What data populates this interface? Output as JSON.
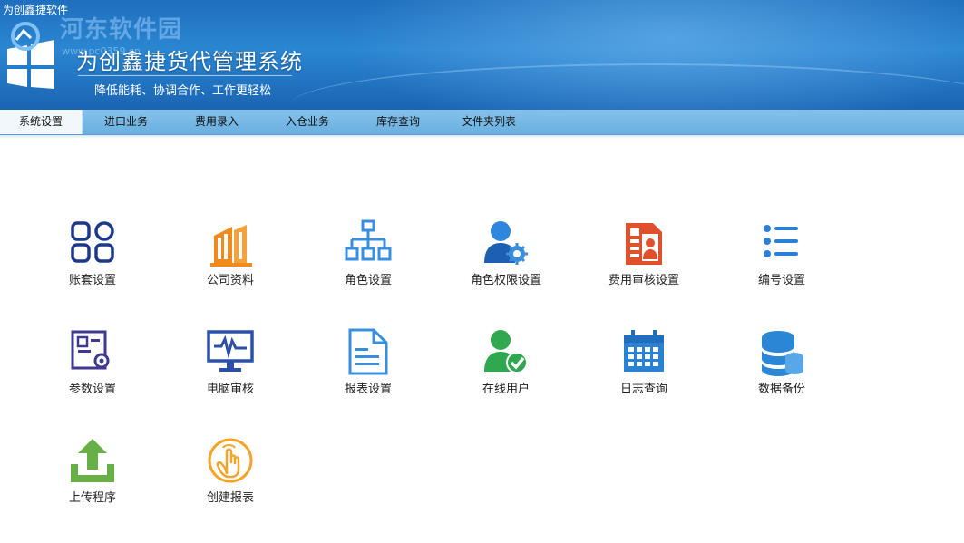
{
  "window": {
    "title": "为创鑫捷软件"
  },
  "banner": {
    "watermark": "河东软件园",
    "watermark_url": "www.pc0359.cn",
    "app_title": "为创鑫捷货代管理系统",
    "subtitle": "降低能耗、协调合作、工作更轻松"
  },
  "menu": {
    "tabs": [
      {
        "label": "系统设置",
        "active": true
      },
      {
        "label": "进口业务"
      },
      {
        "label": "费用录入"
      },
      {
        "label": "入仓业务"
      },
      {
        "label": "库存查询"
      },
      {
        "label": "文件夹列表"
      }
    ]
  },
  "tiles": [
    {
      "label": "账套设置",
      "icon": "grid-icon",
      "color": "#1d3a8a"
    },
    {
      "label": "公司资料",
      "icon": "building-icon",
      "color": "#f08a1c"
    },
    {
      "label": "角色设置",
      "icon": "org-chart-icon",
      "color": "#3a8fdd"
    },
    {
      "label": "角色权限设置",
      "icon": "user-gear-icon",
      "color": "#2f86dd"
    },
    {
      "label": "费用审核设置",
      "icon": "document-user-icon",
      "color": "#e0502c"
    },
    {
      "label": "编号设置",
      "icon": "list-icon",
      "color": "#2b7fd4"
    },
    {
      "label": "参数设置",
      "icon": "settings-doc-icon",
      "color": "#3e3a8f"
    },
    {
      "label": "电脑审核",
      "icon": "monitor-pulse-icon",
      "color": "#2c4fa8"
    },
    {
      "label": "报表设置",
      "icon": "report-doc-icon",
      "color": "#3a8fdd"
    },
    {
      "label": "在线用户",
      "icon": "user-check-icon",
      "color": "#2fa84f"
    },
    {
      "label": "日志查询",
      "icon": "calendar-icon",
      "color": "#2c82d2"
    },
    {
      "label": "数据备份",
      "icon": "database-icon",
      "color": "#2c86d6"
    },
    {
      "label": "上传程序",
      "icon": "upload-icon",
      "color": "#66b047"
    },
    {
      "label": "创建报表",
      "icon": "hand-tap-icon",
      "color": "#f2a52a"
    }
  ]
}
